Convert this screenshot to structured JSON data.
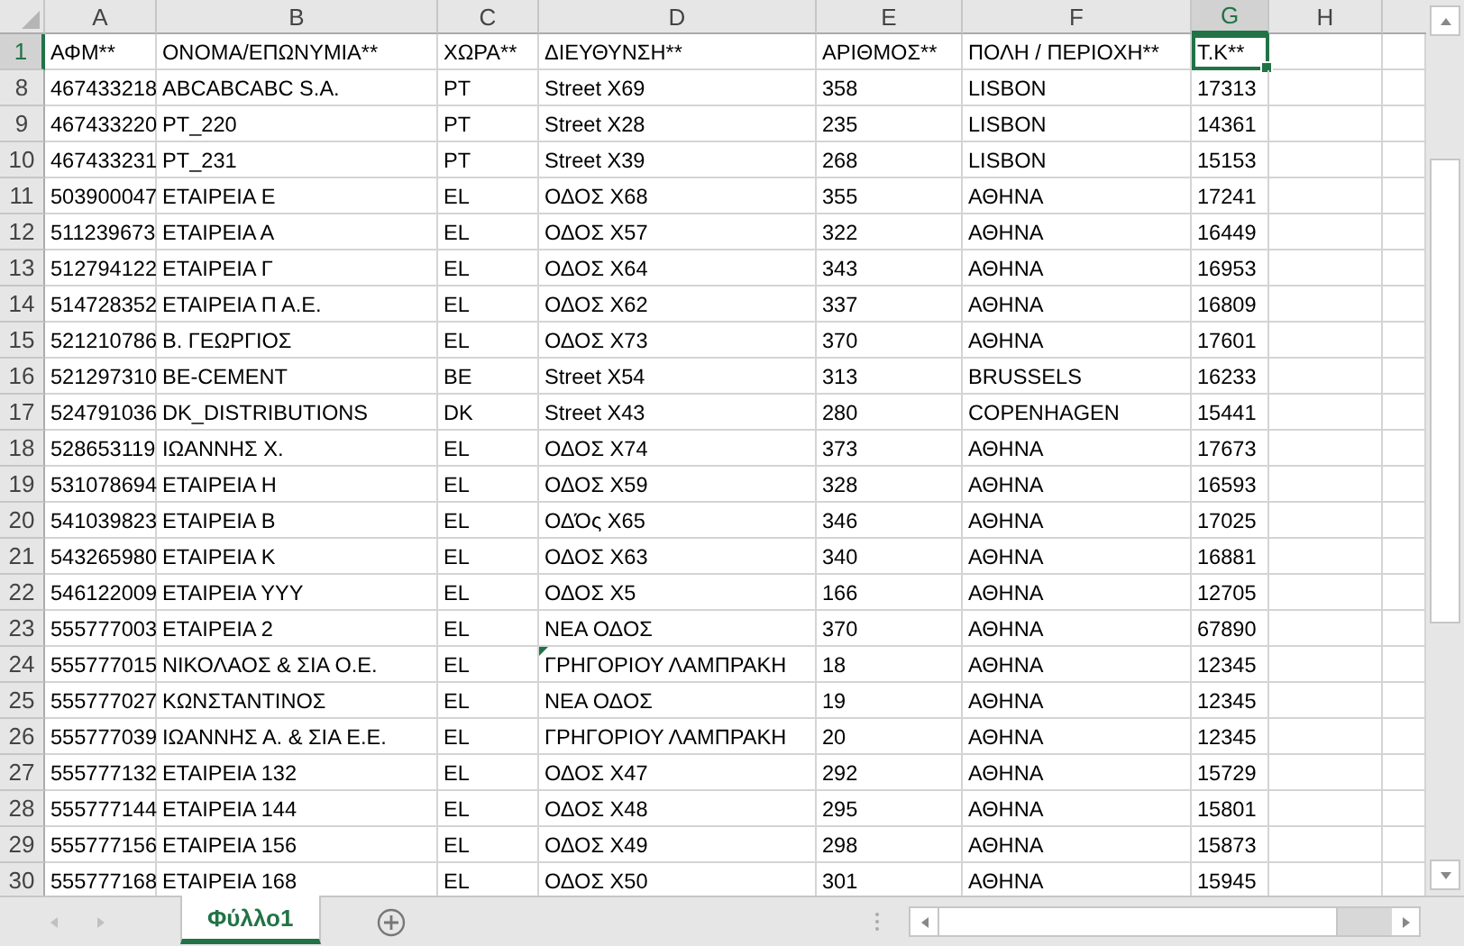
{
  "columns": [
    {
      "letter": "A",
      "selected": false
    },
    {
      "letter": "B",
      "selected": false
    },
    {
      "letter": "C",
      "selected": false
    },
    {
      "letter": "D",
      "selected": false
    },
    {
      "letter": "E",
      "selected": false
    },
    {
      "letter": "F",
      "selected": false
    },
    {
      "letter": "G",
      "selected": true
    },
    {
      "letter": "H",
      "selected": false
    }
  ],
  "rows": [
    {
      "number": "1",
      "selected": true,
      "flagged": false,
      "cells": [
        "ΑΦΜ**",
        "ΟΝΟΜΑ/ΕΠΩΝΥΜΙΑ**",
        "ΧΩΡΑ**",
        "ΔΙΕΥΘΥΝΣΗ**",
        "ΑΡΙΘΜΟΣ**",
        "ΠΟΛΗ / ΠΕΡΙΟΧΗ**",
        "Τ.Κ**"
      ]
    },
    {
      "number": "8",
      "selected": false,
      "flagged": false,
      "cells": [
        "467433218",
        "ABCABCABC S.A.",
        "PT",
        "Street X69",
        "358",
        "LISBON",
        "17313"
      ]
    },
    {
      "number": "9",
      "selected": false,
      "flagged": false,
      "cells": [
        "467433220",
        "PT_220",
        "PT",
        "Street  X28",
        "235",
        "LISBON",
        "14361"
      ]
    },
    {
      "number": "10",
      "selected": false,
      "flagged": false,
      "cells": [
        "467433231",
        "PT_231",
        "PT",
        "Street  X39",
        "268",
        "LISBON",
        "15153"
      ]
    },
    {
      "number": "11",
      "selected": false,
      "flagged": false,
      "cells": [
        "503900047",
        "ΕΤΑΙΡΕΙΑ Ε",
        "EL",
        "ΟΔΟΣ Χ68",
        "355",
        "ΑΘΗΝΑ",
        "17241"
      ]
    },
    {
      "number": "12",
      "selected": false,
      "flagged": false,
      "cells": [
        "511239673",
        "ΕΤΑΙΡΕΙΑ Α",
        "EL",
        "ΟΔΟΣ Χ57",
        "322",
        "ΑΘΗΝΑ",
        "16449"
      ]
    },
    {
      "number": "13",
      "selected": false,
      "flagged": false,
      "cells": [
        "512794122",
        "ΕΤΑΙΡΕΙΑ Γ",
        "EL",
        "ΟΔΟΣ Χ64",
        "343",
        "ΑΘΗΝΑ",
        "16953"
      ]
    },
    {
      "number": "14",
      "selected": false,
      "flagged": false,
      "cells": [
        "514728352",
        "ΕΤΑΙΡΕΙΑ Π Α.Ε.",
        "EL",
        "ΟΔΟΣ Χ62",
        "337",
        "ΑΘΗΝΑ",
        "16809"
      ]
    },
    {
      "number": "15",
      "selected": false,
      "flagged": false,
      "cells": [
        "521210786",
        "Β. ΓΕΩΡΓΙΟΣ",
        "EL",
        "ΟΔΟΣ Χ73",
        "370",
        "ΑΘΗΝΑ",
        "17601"
      ]
    },
    {
      "number": "16",
      "selected": false,
      "flagged": false,
      "cells": [
        "521297310",
        "BE-CEMENT",
        "BE",
        "Street X54",
        "313",
        "BRUSSELS",
        "16233"
      ]
    },
    {
      "number": "17",
      "selected": false,
      "flagged": false,
      "cells": [
        "524791036",
        "DK_DISTRIBUTIONS",
        "DK",
        "Street  X43",
        "280",
        "COPENHAGEN",
        "15441"
      ]
    },
    {
      "number": "18",
      "selected": false,
      "flagged": false,
      "cells": [
        "528653119",
        "ΙΩΑΝΝΗΣ Χ.",
        "EL",
        "ΟΔΟΣ Χ74",
        "373",
        "ΑΘΗΝΑ",
        "17673"
      ]
    },
    {
      "number": "19",
      "selected": false,
      "flagged": false,
      "cells": [
        "531078694",
        "ΕΤΑΙΡΕΙΑ Η",
        "EL",
        "ΟΔΟΣ Χ59",
        "328",
        "ΑΘΗΝΑ",
        "16593"
      ]
    },
    {
      "number": "20",
      "selected": false,
      "flagged": false,
      "cells": [
        "541039823",
        "ΕΤΑΙΡΕΙΑ Β",
        "EL",
        "ΟΔΌς Χ65",
        "346",
        "ΑΘΗΝΑ",
        "17025"
      ]
    },
    {
      "number": "21",
      "selected": false,
      "flagged": false,
      "cells": [
        "543265980",
        "ΕΤΑΙΡΕΙΑ Κ",
        "EL",
        "ΟΔΟΣ Χ63",
        "340",
        "ΑΘΗΝΑ",
        "16881"
      ]
    },
    {
      "number": "22",
      "selected": false,
      "flagged": false,
      "cells": [
        "546122009",
        "ΕΤΑΙΡΕΙΑ ΥΥΥ",
        "EL",
        "ΟΔΟΣ Χ5",
        "166",
        "ΑΘΗΝΑ",
        "12705"
      ]
    },
    {
      "number": "23",
      "selected": false,
      "flagged": false,
      "cells": [
        "555777003",
        "ΕΤΑΙΡΕΙΑ 2",
        "EL",
        "ΝΕΑ ΟΔΟΣ",
        "370",
        "ΑΘΗΝΑ",
        "67890"
      ]
    },
    {
      "number": "24",
      "selected": false,
      "flagged": true,
      "cells": [
        "555777015",
        "ΝΙΚΟΛΑΟΣ & ΣΙΑ Ο.Ε.",
        "EL",
        "ΓΡΗΓΟΡΙΟΥ ΛΑΜΠΡΑΚΗ",
        "18",
        "ΑΘΗΝΑ",
        "12345"
      ]
    },
    {
      "number": "25",
      "selected": false,
      "flagged": false,
      "cells": [
        "555777027",
        "ΚΩΝΣΤΑΝΤΙΝΟΣ",
        "EL",
        "ΝΕΑ ΟΔΟΣ",
        "19",
        "ΑΘΗΝΑ",
        "12345"
      ]
    },
    {
      "number": "26",
      "selected": false,
      "flagged": false,
      "cells": [
        "555777039",
        "ΙΩΑΝΝΗΣ Α. & ΣΙΑ Ε.Ε.",
        "EL",
        "ΓΡΗΓΟΡΙΟΥ ΛΑΜΠΡΑΚΗ",
        "20",
        "ΑΘΗΝΑ",
        "12345"
      ]
    },
    {
      "number": "27",
      "selected": false,
      "flagged": false,
      "cells": [
        "555777132",
        "ΕΤΑΙΡΕΙΑ 132",
        "EL",
        "ΟΔΟΣ Χ47",
        "292",
        "ΑΘΗΝΑ",
        "15729"
      ]
    },
    {
      "number": "28",
      "selected": false,
      "flagged": false,
      "cells": [
        "555777144",
        "ΕΤΑΙΡΕΙΑ 144",
        "EL",
        "ΟΔΟΣ Χ48",
        "295",
        "ΑΘΗΝΑ",
        "15801"
      ]
    },
    {
      "number": "29",
      "selected": false,
      "flagged": false,
      "cells": [
        "555777156",
        "ΕΤΑΙΡΕΙΑ 156",
        "EL",
        "ΟΔΟΣ Χ49",
        "298",
        "ΑΘΗΝΑ",
        "15873"
      ]
    },
    {
      "number": "30",
      "selected": false,
      "flagged": false,
      "cells": [
        "555777168",
        "ΕΤΑΙΡΕΙΑ 168",
        "EL",
        "ΟΔΟΣ Χ50",
        "301",
        "ΑΘΗΝΑ",
        "15945"
      ]
    }
  ],
  "sheet_tabs": [
    {
      "label": "Φύλλο1",
      "selected": true
    }
  ]
}
